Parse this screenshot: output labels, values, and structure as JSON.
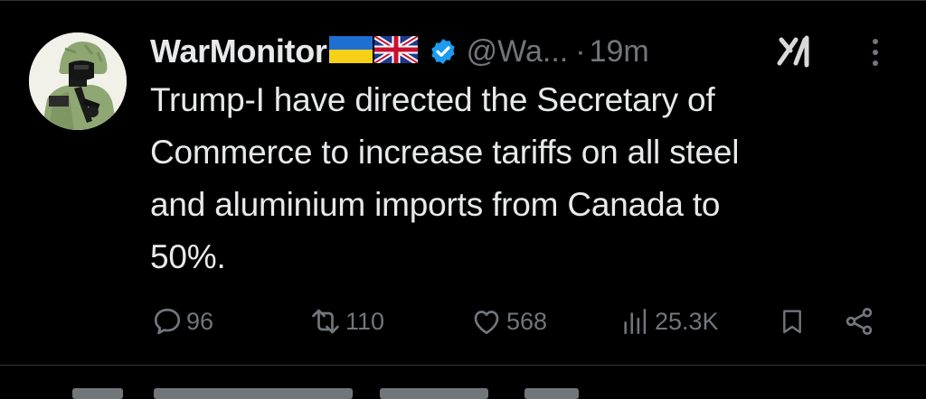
{
  "tweet": {
    "display_name": "WarMonitor",
    "flags": [
      "ukraine-flag",
      "uk-flag"
    ],
    "handle": "@Wa...",
    "separator": "·",
    "time": "19m",
    "text_lines": [
      "Trump-I have directed the Secretary of",
      "Commerce to increase tariffs on all steel",
      "and aluminium imports from Canada to",
      "50%."
    ],
    "stats": {
      "replies": "96",
      "reposts": "110",
      "likes": "568",
      "views": "25.3K"
    }
  },
  "colors": {
    "background": "#000000",
    "text_primary": "#e7e9ea",
    "text_secondary": "#71767b",
    "verified_blue": "#1d9bf0",
    "divider": "#2f3336"
  },
  "icons": {
    "verified": "verified-badge-icon",
    "grok": "grok-icon",
    "more": "more-vertical-icon",
    "reply": "reply-icon",
    "repost": "repost-icon",
    "like": "heart-icon",
    "views": "views-icon",
    "bookmark": "bookmark-icon",
    "share": "share-icon"
  }
}
